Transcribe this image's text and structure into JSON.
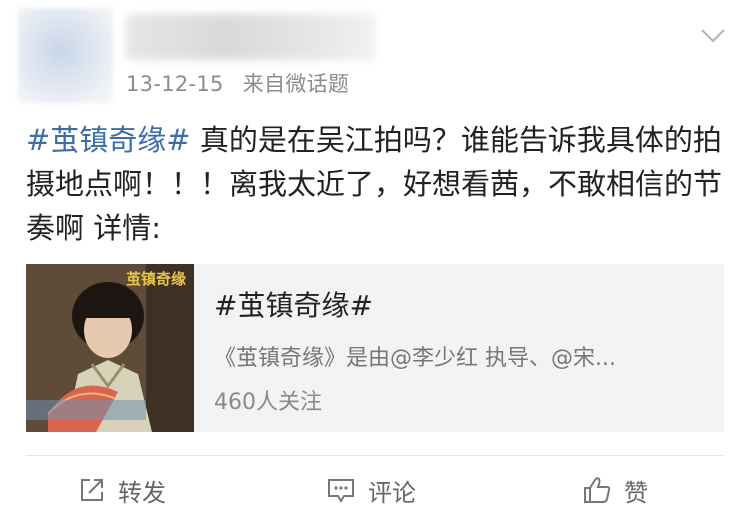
{
  "post": {
    "date": "13-12-15",
    "source": "来自微话题",
    "topic_tag": "#茧镇奇缘#",
    "text": " 真的是在吴江拍吗？谁能告诉我具体的拍摄地点啊！！！离我太近了，好想看茜，不敢相信的节奏啊",
    "details_label": " 详情:"
  },
  "card": {
    "title": "#茧镇奇缘#",
    "description": "《茧镇奇缘》是由@李少红 执导、@宋...",
    "followers": "460人关注",
    "thumbnail_label": "茧镇奇缘"
  },
  "actions": {
    "repost_label": "转发",
    "comment_label": "评论",
    "like_label": "赞"
  },
  "icons": {
    "repost": "share-square-icon",
    "comment": "speech-bubble-icon",
    "like": "thumbs-up-icon",
    "menu": "chevron-down-icon"
  },
  "colors": {
    "topic_link": "#3d6fa6",
    "meta_text": "#8c8c8c",
    "card_bg": "#f3f3f3"
  }
}
